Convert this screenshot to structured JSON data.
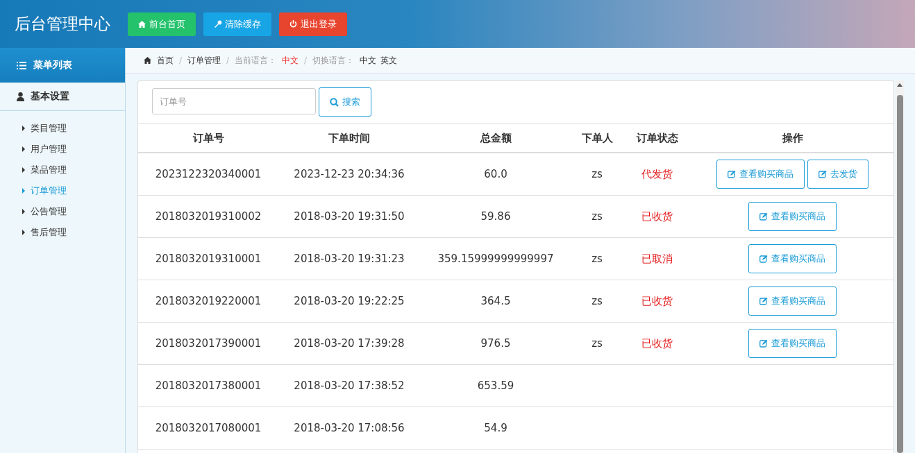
{
  "header": {
    "title": "后台管理中心",
    "buttons": [
      {
        "label": "前台首页",
        "kind": "home"
      },
      {
        "label": "清除缓存",
        "kind": "cache"
      },
      {
        "label": "退出登录",
        "kind": "logout"
      }
    ]
  },
  "sidebar": {
    "title": "菜单列表",
    "group": "基本设置",
    "items": [
      {
        "label": "类目管理",
        "selected": false
      },
      {
        "label": "用户管理",
        "selected": false
      },
      {
        "label": "菜品管理",
        "selected": false
      },
      {
        "label": "订单管理",
        "selected": true
      },
      {
        "label": "公告管理",
        "selected": false
      },
      {
        "label": "售后管理",
        "selected": false
      }
    ]
  },
  "breadcrumb": {
    "separator": "/",
    "home": "首页",
    "current": "订单管理",
    "language_label": "当前语言：",
    "language": "中文",
    "switch_label": "切换语言：",
    "switch_options": [
      "中文",
      "英文"
    ]
  },
  "search": {
    "placeholder": "订单号",
    "button": "搜索"
  },
  "table": {
    "columns": [
      "订单号",
      "下单时间",
      "总金额",
      "下单人",
      "订单状态",
      "操作"
    ],
    "rows": [
      {
        "order_no": "2023122320340001",
        "time": "2023-12-23 20:34:36",
        "total": "60.0",
        "user": "zs",
        "status": "代发货",
        "actions": [
          "查看购买商品",
          "去发货"
        ]
      },
      {
        "order_no": "2018032019310002",
        "time": "2018-03-20 19:31:50",
        "total": "59.86",
        "user": "zs",
        "status": "已收货",
        "actions": [
          "查看购买商品"
        ]
      },
      {
        "order_no": "2018032019310001",
        "time": "2018-03-20 19:31:23",
        "total": "359.15999999999997",
        "user": "zs",
        "status": "已取消",
        "actions": [
          "查看购买商品"
        ]
      },
      {
        "order_no": "2018032019220001",
        "time": "2018-03-20 19:22:25",
        "total": "364.5",
        "user": "zs",
        "status": "已收货",
        "actions": [
          "查看购买商品"
        ]
      },
      {
        "order_no": "2018032017390001",
        "time": "2018-03-20 17:39:28",
        "total": "976.5",
        "user": "zs",
        "status": "已收货",
        "actions": [
          "查看购买商品"
        ]
      },
      {
        "order_no": "2018032017380001",
        "time": "2018-03-20 17:38:52",
        "total": "653.59"
      },
      {
        "order_no": "2018032017080001",
        "time": "2018-03-20 17:08:56",
        "total": "54.9"
      }
    ]
  }
}
